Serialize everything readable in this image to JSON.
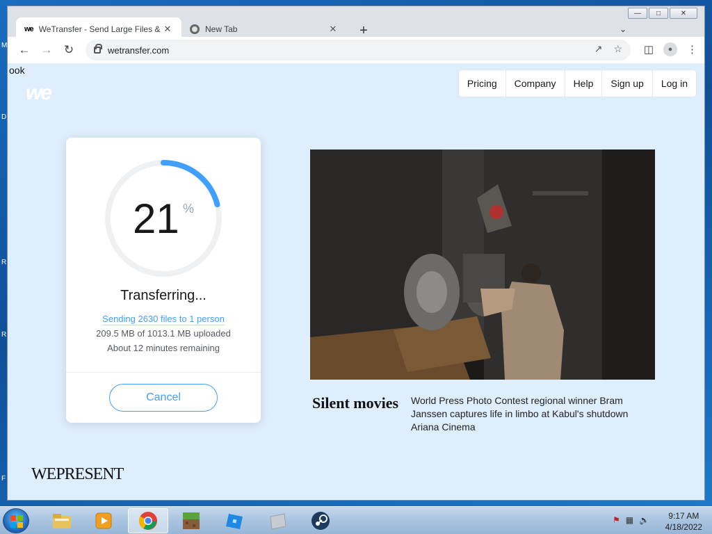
{
  "desktop": {
    "edge_letters": [
      "M",
      "D",
      "R",
      "R",
      "F"
    ]
  },
  "browser": {
    "tabs": [
      {
        "title": "WeTransfer - Send Large Files & Sha",
        "icon": "wetransfer-favicon",
        "active": true
      },
      {
        "title": "New Tab",
        "icon": "chrome-favicon",
        "active": false
      }
    ],
    "url": "wetransfer.com"
  },
  "page": {
    "edge_text": "ook",
    "logo": "we",
    "nav": [
      "Pricing",
      "Company",
      "Help",
      "Sign up",
      "Log in"
    ],
    "transfer": {
      "progress_percent": 21,
      "percent_value": "21",
      "percent_sign": "%",
      "status": "Transferring...",
      "sending_line": "Sending 2630 files to 1 person",
      "uploaded_line": "209.5 MB of 1013.1 MB uploaded",
      "remaining_line": "About 12 minutes remaining",
      "cancel_label": "Cancel",
      "accent_color": "#409fff"
    },
    "feature": {
      "title": "Silent movies",
      "description": "World Press Photo Contest regional winner Bram Janssen captures life in limbo at Kabul's shutdown Ariana Cinema"
    },
    "footer_brand": "WEPRESENT"
  },
  "taskbar": {
    "items": [
      "windows-explorer-icon",
      "media-player-icon",
      "chrome-icon",
      "minecraft-icon",
      "roblox-icon",
      "unknown-app-icon",
      "steam-icon"
    ],
    "active_item": "chrome-icon",
    "clock_time": "9:17 AM",
    "clock_date": "4/18/2022"
  }
}
